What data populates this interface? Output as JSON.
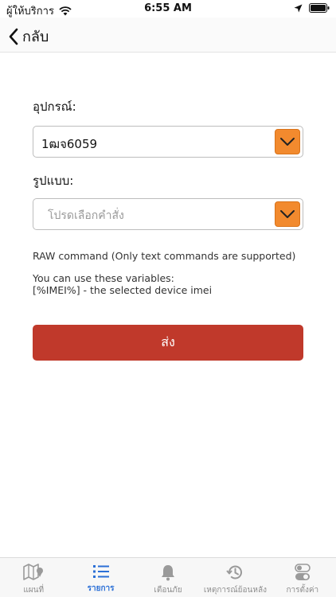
{
  "status_bar": {
    "carrier": "ผู้ให้บริการ",
    "time": "6:55 AM"
  },
  "nav": {
    "back_label": "กลับ"
  },
  "form": {
    "device_label": "อุปกรณ์:",
    "device_value": "1ฒจ6059",
    "type_label": "รูปแบบ:",
    "type_placeholder": "โปรดเลือกคำสั่ง",
    "raw_note": "RAW command (Only text commands are supported)",
    "vars_title": "You can use these variables:",
    "vars_imei": "[%IMEI%] - the selected device imei",
    "send_label": "ส่ง"
  },
  "tabs": [
    {
      "label": "แผนที่",
      "icon": "map-icon",
      "active": false
    },
    {
      "label": "รายการ",
      "icon": "list-icon",
      "active": true
    },
    {
      "label": "เตือนภัย",
      "icon": "bell-icon",
      "active": false
    },
    {
      "label": "เหตุการณ์ย้อนหลัง",
      "icon": "history-icon",
      "active": false
    },
    {
      "label": "การตั้งค่า",
      "icon": "settings-toggle-icon",
      "active": false
    }
  ],
  "colors": {
    "accent_orange": "#f28a2e",
    "send_button": "#c0392b",
    "active_tab": "#2b6fd6",
    "inactive_tab": "#8e8e8e"
  }
}
